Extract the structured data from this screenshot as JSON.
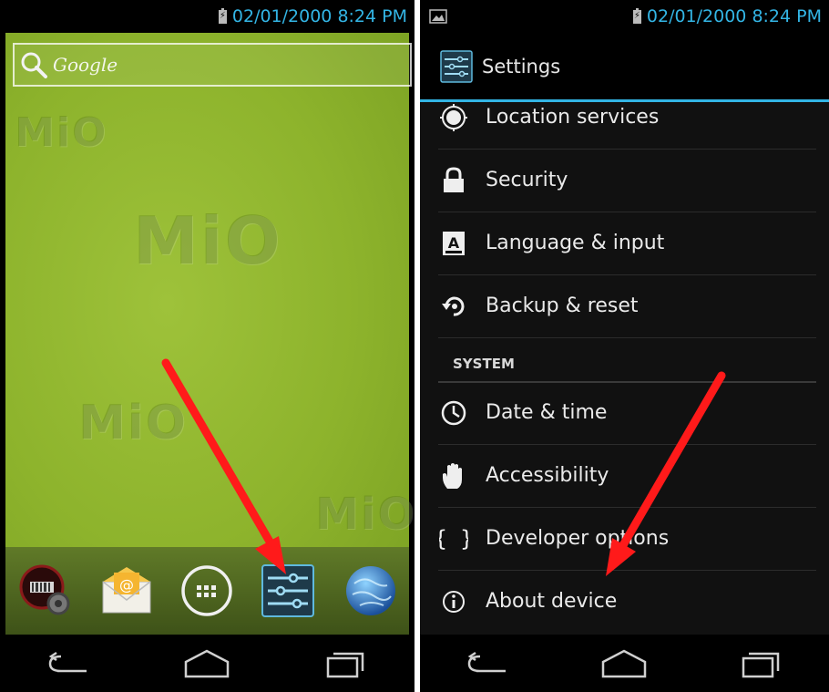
{
  "left_screen": {
    "status_time": "02/01/2000 8:24  PM",
    "search_text": "Google",
    "wallpaper_brand": "MiO"
  },
  "right_screen": {
    "status_time": "02/01/2000 8:24  PM",
    "title": "Settings",
    "items_top": [
      {
        "label": "Location services",
        "icon": "location-icon"
      },
      {
        "label": "Security",
        "icon": "lock-icon"
      },
      {
        "label": "Language & input",
        "icon": "language-icon"
      },
      {
        "label": "Backup & reset",
        "icon": "backup-icon"
      }
    ],
    "section_header": "SYSTEM",
    "items_system": [
      {
        "label": "Date & time",
        "icon": "clock-icon"
      },
      {
        "label": "Accessibility",
        "icon": "hand-icon"
      },
      {
        "label": "Developer options",
        "icon": "braces-icon"
      },
      {
        "label": "About device",
        "icon": "info-icon"
      }
    ]
  },
  "colors": {
    "accent": "#33b5e5",
    "arrow": "#ff1a1a",
    "wallpaper": "#8db32c"
  }
}
